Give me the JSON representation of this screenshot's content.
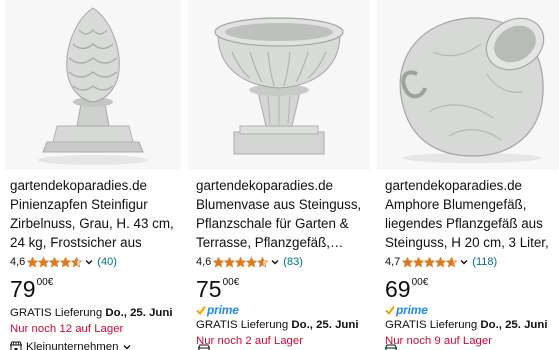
{
  "products": [
    {
      "brand": "gartendekoparadies.de",
      "title": "Pinienzapfen Steinfigur Zirbelnuss, Grau, H. 43 cm, 24 kg, Frostsicher aus Steinguss…",
      "rating": "4,6",
      "rating_value": 4.6,
      "reviews": "(40)",
      "price_whole": "79",
      "price_fraction": "00",
      "currency": "€",
      "prime": false,
      "delivery_prefix": "GRATIS Lieferung",
      "delivery_date": "Do., 25. Juni",
      "stock": "Nur noch 12 auf Lager",
      "seller_badge": "Kleinunternehmen"
    },
    {
      "brand": "gartendekoparadies.de",
      "title": "Blumenvase aus Steinguss, Pflanzschale für Garten & Terrasse, Pflanzgefäß,…",
      "rating": "4,6",
      "rating_value": 4.6,
      "reviews": "(83)",
      "price_whole": "75",
      "price_fraction": "00",
      "currency": "€",
      "prime": true,
      "prime_label": "prime",
      "delivery_prefix": "GRATIS Lieferung",
      "delivery_date": "Do., 25. Juni",
      "stock": "Nur noch 2 auf Lager"
    },
    {
      "brand": "gartendekoparadies.de",
      "title": "Amphore Blumengefäß, liegendes Pflanzgefäß aus Steinguss, H 20 cm, 3 Liter, 1…",
      "rating": "4,7",
      "rating_value": 4.7,
      "reviews": "(118)",
      "price_whole": "69",
      "price_fraction": "00",
      "currency": "€",
      "prime": true,
      "prime_label": "prime",
      "delivery_prefix": "GRATIS Lieferung",
      "delivery_date": "Do., 25. Juni",
      "stock": "Nur noch 9 auf Lager"
    }
  ],
  "colors": {
    "star": "#de7921",
    "link": "#007185",
    "stock": "#cc0c39",
    "prime": "#1f8ded",
    "text": "#0f1111",
    "image_bg": "#f7f7f7"
  },
  "icons": {
    "star": "star-icon",
    "chevron": "chevron-down-icon",
    "prime_check": "prime-check-icon",
    "seller": "small-business-icon"
  }
}
